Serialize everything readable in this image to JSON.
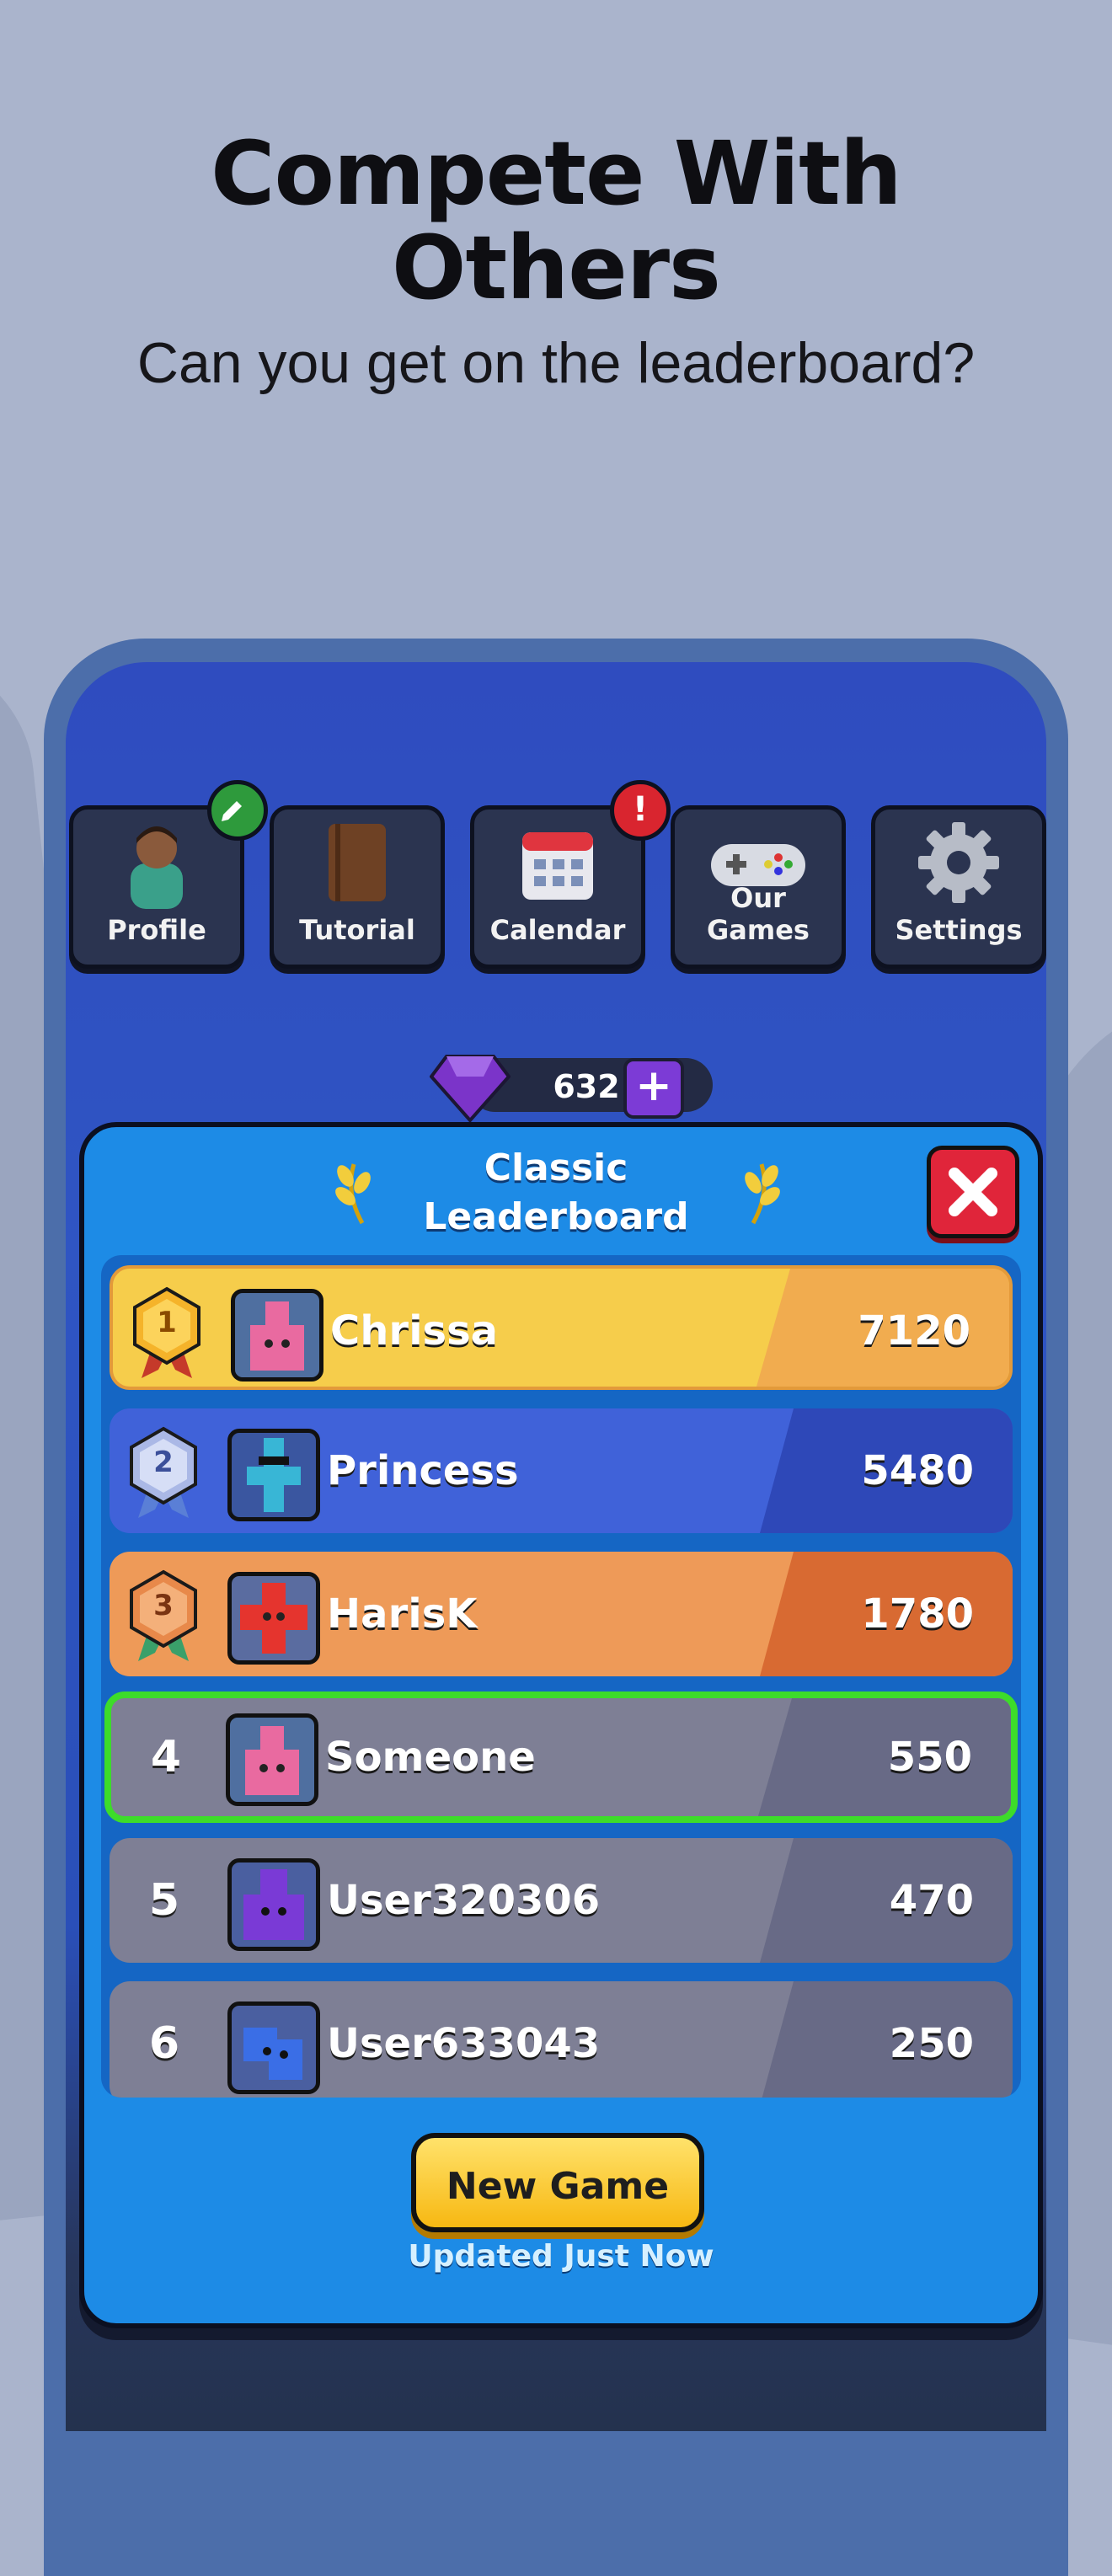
{
  "promo": {
    "title_line1": "Compete With",
    "title_line2": "Others",
    "subtitle": "Can you get on the leaderboard?"
  },
  "menu": [
    {
      "label": "Profile",
      "icon": "profile-icon"
    },
    {
      "label": "Tutorial",
      "icon": "book-icon"
    },
    {
      "label": "Calendar",
      "icon": "calendar-icon"
    },
    {
      "label": "Our Games",
      "icon": "gamepad-icon"
    },
    {
      "label": "Settings",
      "icon": "gear-icon"
    }
  ],
  "badges": {
    "profile": "pencil-icon",
    "calendar_alert": "!"
  },
  "gems": {
    "count": "632",
    "icon": "gem-icon",
    "plus": "+"
  },
  "leaderboard": {
    "title_line1": "Classic",
    "title_line2": "Leaderboard",
    "close_icon": "close-icon",
    "rows": [
      {
        "rank": "1",
        "name": "Chrissa",
        "score": "7120"
      },
      {
        "rank": "2",
        "name": "Princess",
        "score": "5480"
      },
      {
        "rank": "3",
        "name": "HarisK",
        "score": "1780"
      },
      {
        "rank": "4",
        "name": "Someone",
        "score": "550"
      },
      {
        "rank": "5",
        "name": "User320306",
        "score": "470"
      },
      {
        "rank": "6",
        "name": "User633043",
        "score": "250"
      }
    ],
    "new_game": "New Game",
    "updated": "Updated Just Now"
  },
  "colors": {
    "gold": "#f6cd4b",
    "silver_blue": "#4062d9",
    "bronze": "#ee9a58",
    "highlight": "#3ddc2a",
    "normal_row": "#7e7f95"
  }
}
